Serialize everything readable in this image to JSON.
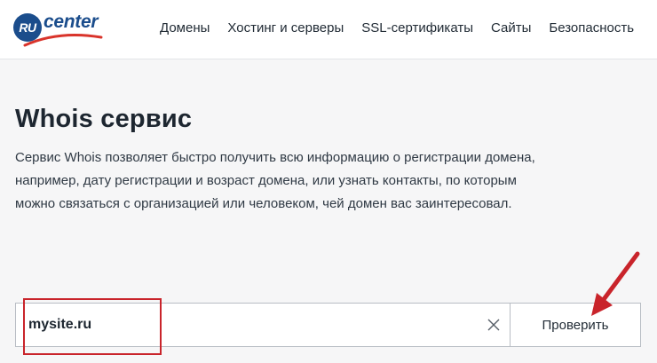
{
  "header": {
    "logo": {
      "badge": "RU",
      "text": "center"
    },
    "nav": [
      {
        "label": "Домены"
      },
      {
        "label": "Хостинг и серверы"
      },
      {
        "label": "SSL-сертификаты"
      },
      {
        "label": "Сайты"
      },
      {
        "label": "Безопасность"
      }
    ]
  },
  "main": {
    "title": "Whois сервис",
    "description": "Сервис Whois позволяет быстро получить всю информацию о регистрации домена, например, дату регистрации и возраст домена, или узнать контакты, по которым можно связаться с организацией или человеком, чей домен вас заинтересовал."
  },
  "search": {
    "value": "mysite.ru",
    "button_label": "Проверить"
  },
  "icons": {
    "clear": "close-icon"
  },
  "colors": {
    "brand": "#1b4d8c",
    "logo_swoosh": "#d9342b",
    "annotation": "#c9242b",
    "page_background": "#f6f6f7"
  }
}
